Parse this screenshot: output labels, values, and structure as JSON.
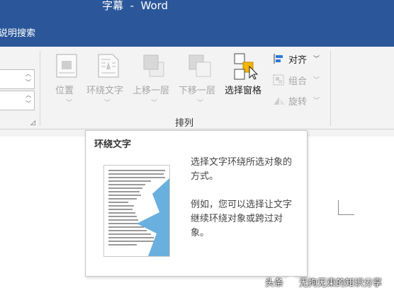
{
  "window": {
    "title": "字幕  -  Word"
  },
  "menubar": {
    "tell_me": "说明搜索"
  },
  "ribbon": {
    "group_label": "排列",
    "buttons": {
      "position": "位置",
      "wrap_text": "环绕文字",
      "bring_forward": "上移一层",
      "send_backward": "下移一层",
      "selection_pane": "选择窗格",
      "align": "对齐",
      "group": "组合",
      "rotate": "旋转"
    }
  },
  "tooltip": {
    "title": "环绕文字",
    "desc": "选择文字环绕所选对象的方式。",
    "example": "例如，您可以选择让文字继续环绕对象或跨过对象。"
  },
  "watermark": {
    "prefix": "头条",
    "author": "无拘无束的知识分享"
  },
  "colors": {
    "title_bar": "#2b579a",
    "accent_blue": "#6ab0de",
    "ribbon_bg": "#f3f3f3"
  }
}
